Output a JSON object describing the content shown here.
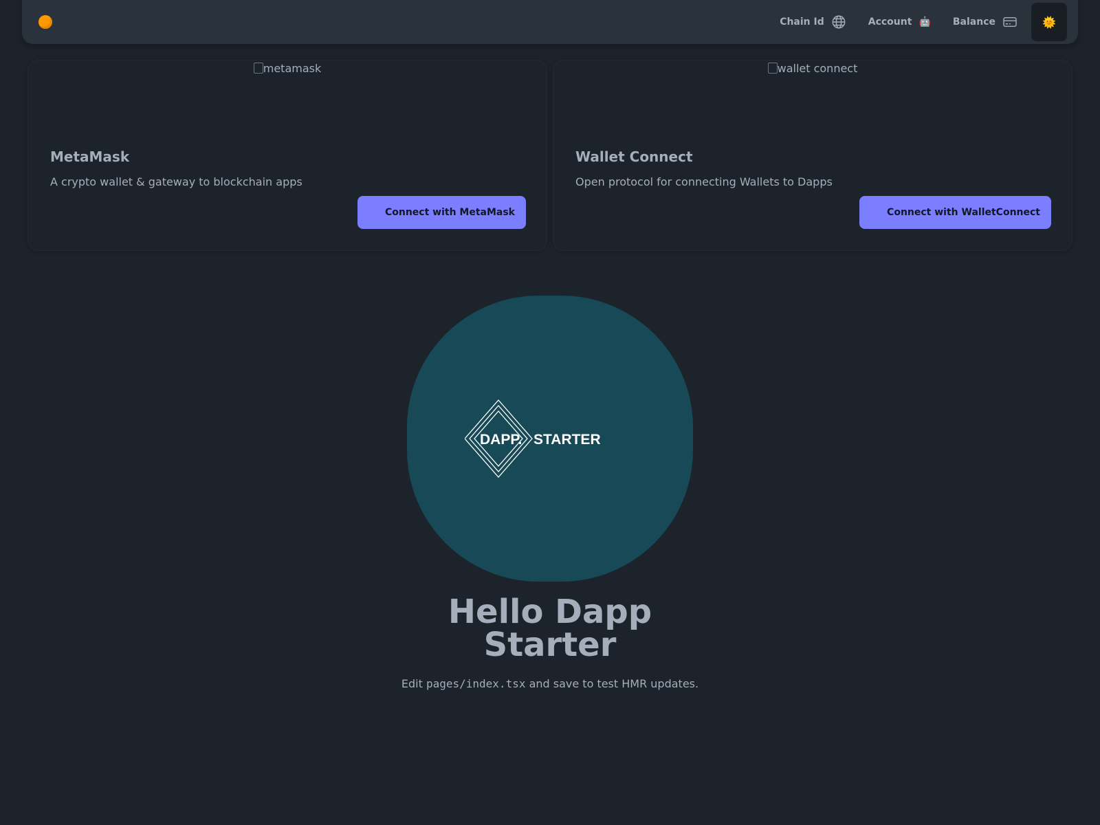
{
  "navbar": {
    "logo_icon": "orange-circle-icon",
    "chain_id_label": "Chain Id",
    "chain_id_icon": "globe-icon",
    "account_label": "Account",
    "account_icon": "robot-icon",
    "balance_label": "Balance",
    "balance_icon": "credit-card-icon",
    "theme_icon": "sun-icon",
    "theme_glyph": "🌞"
  },
  "cards": [
    {
      "image_alt": "metamask",
      "title": "MetaMask",
      "description": "A crypto wallet & gateway to blockchain apps",
      "button_label": "Connect with MetaMask"
    },
    {
      "image_alt": "wallet connect",
      "title": "Wallet Connect",
      "description": "Open protocol for connecting Wallets to Dapps",
      "button_label": "Connect with WalletConnect"
    }
  ],
  "hero": {
    "logo_text_left": "DAPP.",
    "logo_text_right": "STARTER",
    "heading_line1": "Hello Dapp",
    "heading_line2": "Starter",
    "edit_prefix": "Edit",
    "edit_code": "pages/index.tsx",
    "edit_suffix": "and save to test HMR updates."
  },
  "colors": {
    "background": "#1d232a",
    "navbar": "#2a323c",
    "primary_button": "#7b7fff",
    "hero_blob": "#174956",
    "logo_dot": "#ff9900"
  }
}
